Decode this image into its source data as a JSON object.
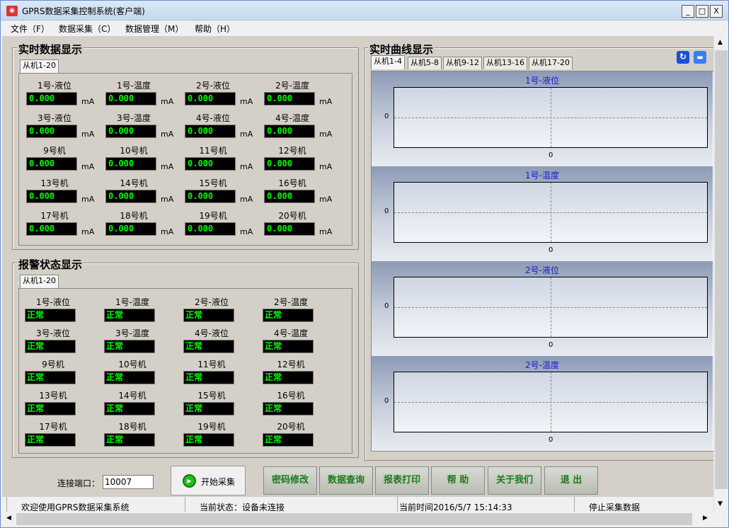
{
  "window": {
    "title": "GPRS数据采集控制系统(客户端)",
    "icon": "app-icon",
    "min": "_",
    "max": "□",
    "close": "X"
  },
  "menu": [
    "文件（F）",
    "数据采集（C）",
    "数据管理（M）",
    "帮助（H）"
  ],
  "realtime": {
    "title": "实时数据显示",
    "tab": "从机1-20",
    "unit": "mA",
    "items": [
      {
        "label": "1号-液位",
        "value": "0.000"
      },
      {
        "label": "1号-温度",
        "value": "0.000"
      },
      {
        "label": "2号-液位",
        "value": "0.000"
      },
      {
        "label": "2号-温度",
        "value": "0.000"
      },
      {
        "label": "3号-液位",
        "value": "0.000"
      },
      {
        "label": "3号-温度",
        "value": "0.000"
      },
      {
        "label": "4号-液位",
        "value": "0.000"
      },
      {
        "label": "4号-温度",
        "value": "0.000"
      },
      {
        "label": "9号机",
        "value": "0.000"
      },
      {
        "label": "10号机",
        "value": "0.000"
      },
      {
        "label": "11号机",
        "value": "0.000"
      },
      {
        "label": "12号机",
        "value": "0.000"
      },
      {
        "label": "13号机",
        "value": "0.000"
      },
      {
        "label": "14号机",
        "value": "0.000"
      },
      {
        "label": "15号机",
        "value": "0.000"
      },
      {
        "label": "16号机",
        "value": "0.000"
      },
      {
        "label": "17号机",
        "value": "0.000"
      },
      {
        "label": "18号机",
        "value": "0.000"
      },
      {
        "label": "19号机",
        "value": "0.000"
      },
      {
        "label": "20号机",
        "value": "0.000"
      }
    ]
  },
  "alarm": {
    "title": "报警状态显示",
    "tab": "从机1-20",
    "items": [
      {
        "label": "1号-液位",
        "status": "正常"
      },
      {
        "label": "1号-温度",
        "status": "正常"
      },
      {
        "label": "2号-液位",
        "status": "正常"
      },
      {
        "label": "2号-温度",
        "status": "正常"
      },
      {
        "label": "3号-液位",
        "status": "正常"
      },
      {
        "label": "3号-温度",
        "status": "正常"
      },
      {
        "label": "4号-液位",
        "status": "正常"
      },
      {
        "label": "4号-温度",
        "status": "正常"
      },
      {
        "label": "9号机",
        "status": "正常"
      },
      {
        "label": "10号机",
        "status": "正常"
      },
      {
        "label": "11号机",
        "status": "正常"
      },
      {
        "label": "12号机",
        "status": "正常"
      },
      {
        "label": "13号机",
        "status": "正常"
      },
      {
        "label": "14号机",
        "status": "正常"
      },
      {
        "label": "15号机",
        "status": "正常"
      },
      {
        "label": "16号机",
        "status": "正常"
      },
      {
        "label": "17号机",
        "status": "正常"
      },
      {
        "label": "18号机",
        "status": "正常"
      },
      {
        "label": "19号机",
        "status": "正常"
      },
      {
        "label": "20号机",
        "status": "正常"
      }
    ]
  },
  "curves": {
    "title": "实时曲线显示",
    "tabs": [
      "从机1-4",
      "从机5-8",
      "从机9-12",
      "从机13-16",
      "从机17-20"
    ],
    "icons": [
      "refresh-icon",
      "save-icon"
    ],
    "charts": [
      {
        "title": "1号-液位",
        "ytick": "0",
        "xtick": "0"
      },
      {
        "title": "1号-温度",
        "ytick": "0",
        "xtick": "0"
      },
      {
        "title": "2号-液位",
        "ytick": "0",
        "xtick": "0"
      },
      {
        "title": "2号-温度",
        "ytick": "0",
        "xtick": "0"
      }
    ]
  },
  "controls": {
    "port_label": "连接端口：",
    "port_value": "10007",
    "start_button": "开始采集",
    "buttons": [
      "密码修改",
      "数据查询",
      "报表打印",
      "帮 助",
      "关于我们",
      "退 出"
    ]
  },
  "statusbar": [
    "欢迎使用GPRS数据采集系统",
    "当前状态：设备未连接",
    "当前时间2016/5/7 15:14:33",
    "停止采集数据"
  ],
  "colors": {
    "lcd_bg": "#000000",
    "lcd_text": "#00ff00",
    "chart_title": "#1a1acc",
    "button_text": "#1a7a1a"
  }
}
